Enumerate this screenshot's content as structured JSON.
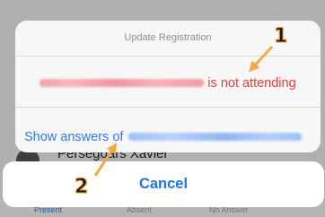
{
  "background": {
    "member_name": "Persegoars Xavier",
    "tabs": [
      "Present",
      "Absent",
      "No Answer"
    ]
  },
  "sheet": {
    "title": "Update Registration",
    "option_not_attending_suffix": "is not attending",
    "option_show_answers_prefix": "Show answers of",
    "cancel_label": "Cancel"
  },
  "annotations": {
    "marker_1": "1",
    "marker_2": "2",
    "color": "#f2a94a"
  },
  "colors": {
    "destructive": "#ef3b30",
    "action": "#2f7bf0",
    "cancel": "#1f72ee"
  }
}
